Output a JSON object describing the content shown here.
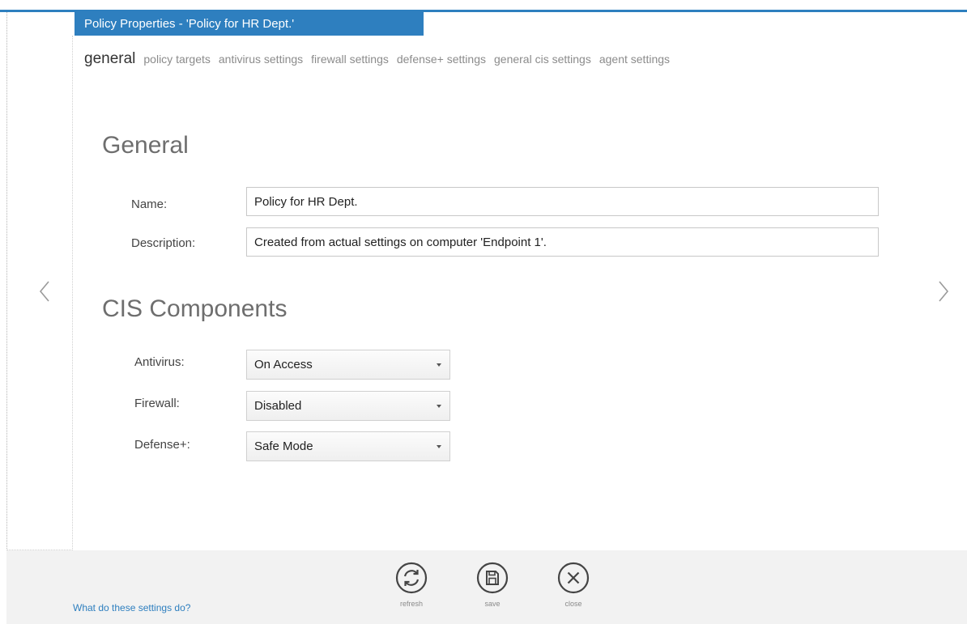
{
  "window": {
    "title": "Policy Properties - 'Policy for HR Dept.'"
  },
  "tabs": [
    {
      "label": "general",
      "active": true
    },
    {
      "label": "policy targets",
      "active": false
    },
    {
      "label": "antivirus settings",
      "active": false
    },
    {
      "label": "firewall settings",
      "active": false
    },
    {
      "label": "defense+ settings",
      "active": false
    },
    {
      "label": "general cis settings",
      "active": false
    },
    {
      "label": "agent settings",
      "active": false
    }
  ],
  "general": {
    "heading": "General",
    "name_label": "Name:",
    "name_value": "Policy for HR Dept.",
    "description_label": "Description:",
    "description_value": "Created from actual settings on computer 'Endpoint 1'."
  },
  "components": {
    "heading": "CIS Components",
    "antivirus_label": "Antivirus:",
    "antivirus_value": "On Access",
    "firewall_label": "Firewall:",
    "firewall_value": "Disabled",
    "defense_label": "Defense+:",
    "defense_value": "Safe Mode"
  },
  "navigation": {
    "prev_icon": "chevron-left-icon",
    "next_icon": "chevron-right-icon"
  },
  "footer": {
    "help_link": "What do these settings do?",
    "actions": {
      "refresh": {
        "label": "refresh",
        "icon": "refresh-icon"
      },
      "save": {
        "label": "save",
        "icon": "save-icon"
      },
      "close": {
        "label": "close",
        "icon": "close-icon"
      }
    }
  },
  "colors": {
    "accent": "#2e7fbf",
    "footer_bg": "#f2f2f2",
    "icon": "#444444"
  }
}
